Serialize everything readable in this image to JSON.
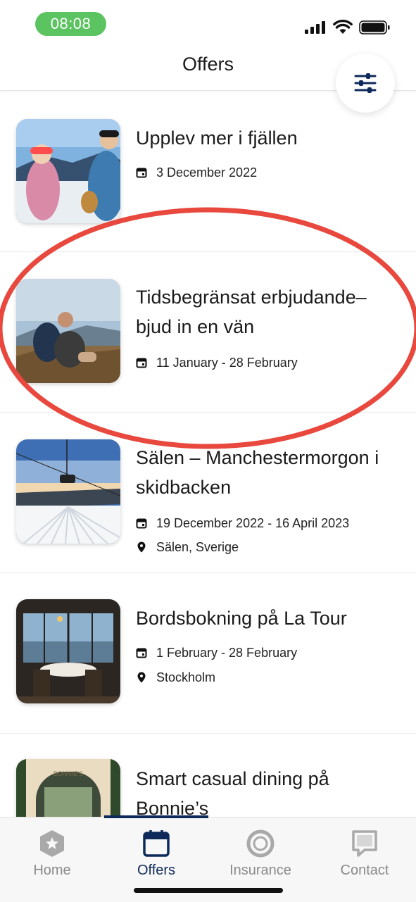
{
  "status_bar": {
    "time": "08:08"
  },
  "header": {
    "title": "Offers"
  },
  "offers": [
    {
      "title": "Upplev mer i fjällen",
      "date": "3 December 2022",
      "location": ""
    },
    {
      "title": "Tidsbegränsat erbjudande– bjud in en vän",
      "date": "11 January - 28 February",
      "location": ""
    },
    {
      "title": "Sälen – Manchestermorgon i skidbacken",
      "date": "19 December 2022 - 16 April 2023",
      "location": "Sälen, Sverige"
    },
    {
      "title": "Bordsbokning på La Tour",
      "date": "1 February - 28 February",
      "location": "Stockholm"
    },
    {
      "title": "Smart casual dining på Bonnie’s",
      "date": "",
      "location": ""
    }
  ],
  "tabs": [
    {
      "label": "Home",
      "icon": "shield-star-icon",
      "active": false
    },
    {
      "label": "Offers",
      "icon": "calendar-icon",
      "active": true
    },
    {
      "label": "Insurance",
      "icon": "lifebuoy-icon",
      "active": false
    },
    {
      "label": "Contact",
      "icon": "chat-bubble-icon",
      "active": false
    }
  ],
  "colors": {
    "accent": "#0e2a5a",
    "status_pill": "#5bc35f",
    "annotation": "#e8483d",
    "inactive_tab": "#8a8a8a"
  }
}
